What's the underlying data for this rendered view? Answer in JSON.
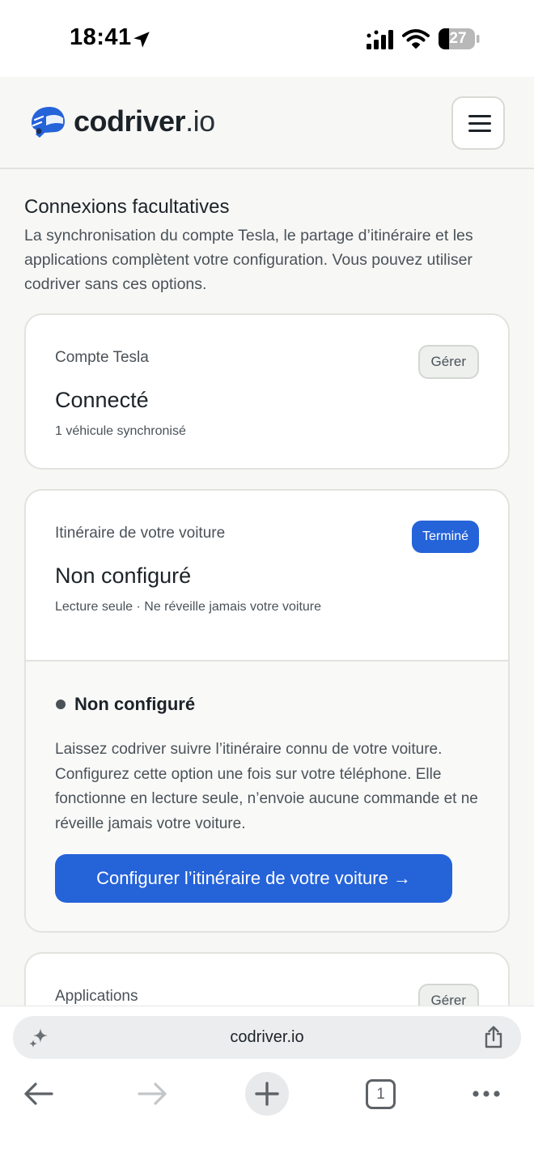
{
  "status_bar": {
    "time": "18:41",
    "battery": "27"
  },
  "header": {
    "brand_main": "codriver",
    "brand_tld": ".io"
  },
  "intro": {
    "title": "Connexions facultatives",
    "text": "La synchronisation du compte Tesla, le partage d’itinéraire et les applications complètent votre configuration. Vous pouvez utiliser codriver sans ces options."
  },
  "tesla_card": {
    "label": "Compte Tesla",
    "manage": "Gérer",
    "status": "Connecté",
    "sub": "1 véhicule synchronisé"
  },
  "route_card": {
    "label": "Itinéraire de votre voiture",
    "badge": "Terminé",
    "status": "Non configuré",
    "sub": "Lecture seule · Ne réveille jamais votre voiture",
    "detail_title": "Non configuré",
    "detail_text": "Laissez codriver suivre l’itinéraire connu de votre voiture. Configurez cette option une fois sur votre téléphone. Elle fonctionne en lecture seule, n’envoie aucune commande et ne réveille jamais votre voiture.",
    "cta": "Configurer l’itinéraire de votre voiture →"
  },
  "apps_card": {
    "label": "Applications",
    "manage": "Gérer"
  },
  "browser": {
    "url": "codriver.io",
    "tab_count": "1"
  },
  "colors": {
    "accent": "#2563d9",
    "text": "#1c2328",
    "muted": "#4a5258"
  },
  "icons": [
    "location-arrow-icon",
    "signal-icon",
    "wifi-icon",
    "battery-icon",
    "helmet-logo-icon",
    "hamburger-menu-icon",
    "sparkle-icon",
    "share-icon",
    "back-arrow-icon",
    "forward-arrow-icon",
    "new-tab-icon",
    "tabs-icon",
    "more-icon"
  ]
}
